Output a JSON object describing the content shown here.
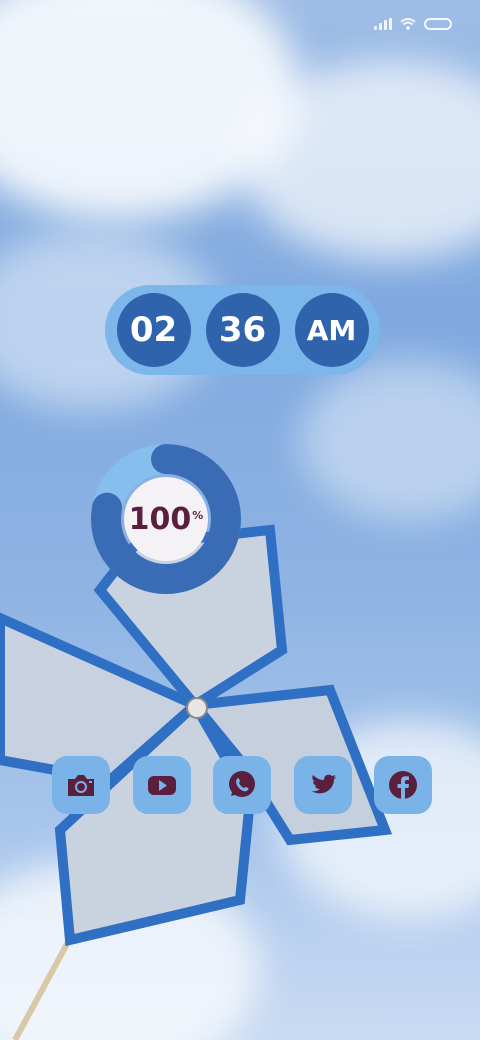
{
  "statusbar": {
    "icons": [
      "signal-icon",
      "wifi-icon",
      "battery-icon"
    ]
  },
  "clock": {
    "hour": "02",
    "minute": "36",
    "period": "AM"
  },
  "battery_widget": {
    "percent_value": "100",
    "percent_sign": "%",
    "level": 100
  },
  "dock": {
    "apps": [
      {
        "name": "camera",
        "icon": "camera-icon"
      },
      {
        "name": "youtube",
        "icon": "youtube-icon"
      },
      {
        "name": "whatsapp",
        "icon": "whatsapp-icon"
      },
      {
        "name": "twitter",
        "icon": "twitter-icon"
      },
      {
        "name": "facebook",
        "icon": "facebook-icon"
      }
    ]
  },
  "colors": {
    "clock_bg": "#7cb6ea",
    "clock_pill": "#2f64ad",
    "icon_tile": "#79b3e8",
    "icon_glyph": "#5a1f3c",
    "ring_dark": "#3a6cb5",
    "ring_light": "#86bfee"
  }
}
